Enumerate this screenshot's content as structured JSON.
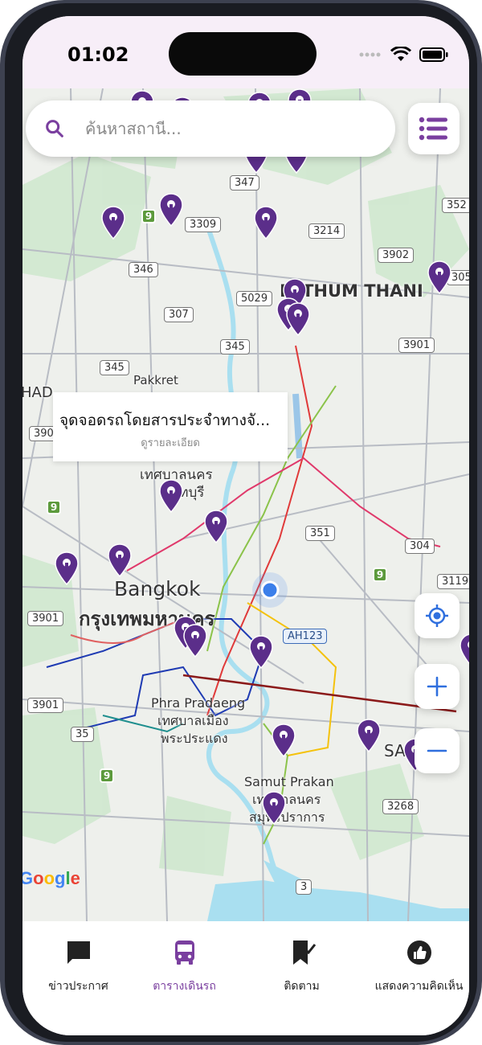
{
  "status_bar": {
    "time": "01:02"
  },
  "search": {
    "placeholder": "ค้นหาสถานี..."
  },
  "popup": {
    "title": "จุดจอดรถโดยสารประจำทางจั...",
    "subtitle": "ดูรายละเอียด"
  },
  "map": {
    "labels": {
      "pathum_thani": "PATHUM THANI",
      "pakkret": "Pakkret",
      "pakkret_thai_1": "เทศบาลนคร",
      "pakkret_thai_2": "นนทบุรี",
      "bangkok_en": "Bangkok",
      "bangkok_th": "กรุงเทพมหานคร",
      "phra_pradaeng_1": "Phra Pradaeng",
      "phra_pradaeng_2": "เทศบาลเมือง",
      "phra_pradaeng_3": "พระประแดง",
      "samut_prakan_1": "Samut Prakan",
      "samut_prakan_2": "เทศบาลนคร",
      "samut_prakan_3": "สมุทรปราการ",
      "sa": "SA",
      "had": "HAD"
    },
    "road_shields": {
      "r1": "3309",
      "r2": "3214",
      "r3": "352",
      "r4": "346",
      "r5": "3902",
      "r6": "305",
      "r7": "5029",
      "r8": "307",
      "r9": "345",
      "r10": "3901",
      "r11": "345",
      "r12": "347",
      "r13": "390",
      "r14": "351",
      "r15": "304",
      "r16": "3119",
      "r17": "3901",
      "r18": "AH123",
      "r19": "3901",
      "r20": "35",
      "r21": "3268",
      "r22": "3",
      "r23": "3"
    },
    "green_shields": {
      "g1": "9",
      "g2": "9",
      "g3": "9",
      "g4": "9"
    },
    "attribution": "Google"
  },
  "tabs": [
    {
      "label": "ข่าวประกาศ",
      "icon": "chat-icon"
    },
    {
      "label": "ตารางเดินรถ",
      "icon": "bus-icon"
    },
    {
      "label": "ติดตาม",
      "icon": "bookmark-icon"
    },
    {
      "label": "แสดงความคิดเห็น",
      "icon": "like-icon"
    }
  ],
  "colors": {
    "accent": "#7a3f9f",
    "pin": "#5b2e8a"
  }
}
